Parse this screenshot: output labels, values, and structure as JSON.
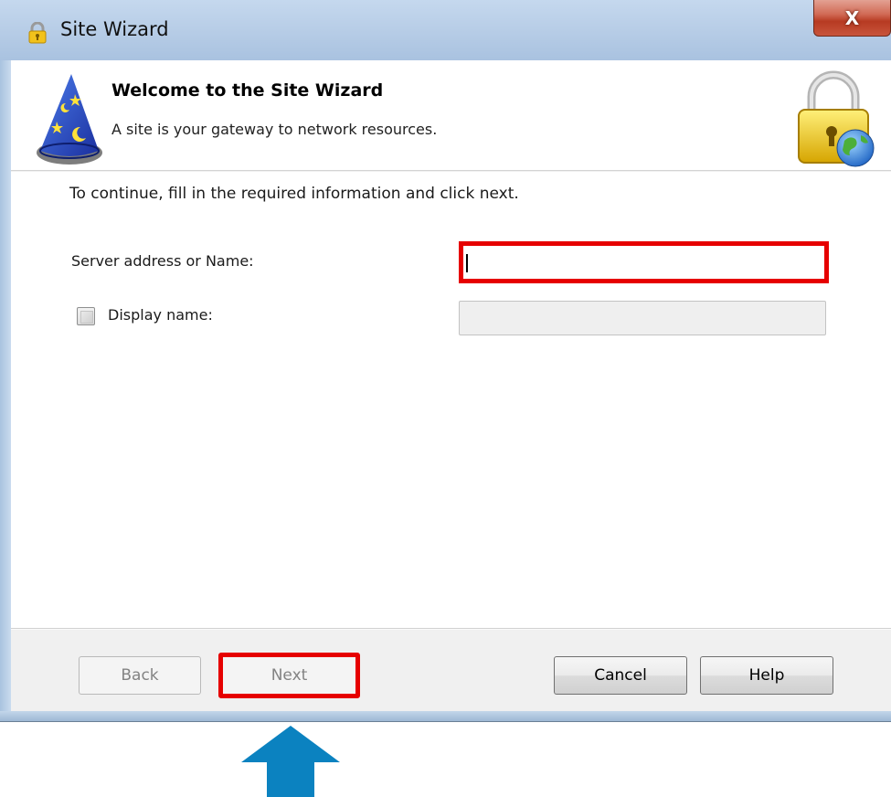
{
  "window": {
    "title": "Site Wizard",
    "close_glyph": "X"
  },
  "header": {
    "title": "Welcome to the Site Wizard",
    "subtitle": "A site is your gateway to network resources."
  },
  "body": {
    "instruction": "To continue, fill in the required information and click next.",
    "server_label": "Server address or Name:",
    "server_value": "",
    "display_label": "Display name:",
    "display_checked": false,
    "display_value": ""
  },
  "footer": {
    "back": "Back",
    "next": "Next",
    "cancel": "Cancel",
    "help": "Help"
  },
  "colors": {
    "highlight": "#e60000",
    "arrow": "#0b82c0"
  },
  "icons": {
    "title": "padlock-icon",
    "wizard": "wizard-hat-icon",
    "lock": "lock-globe-icon",
    "annotation": "arrow-up-icon"
  }
}
